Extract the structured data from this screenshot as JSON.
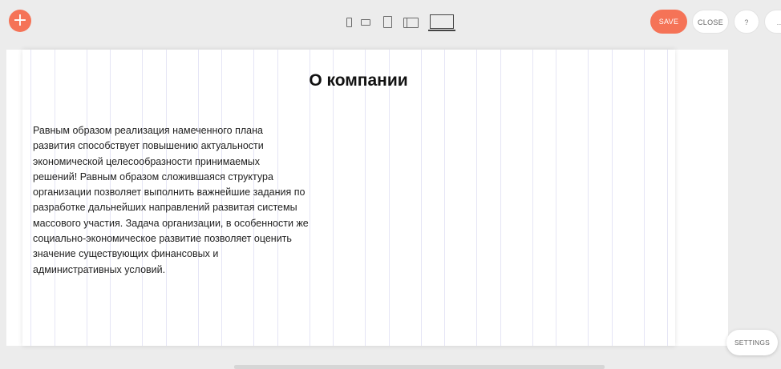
{
  "toolbar": {
    "add_label": "+",
    "devices": [
      {
        "name": "mobile-portrait"
      },
      {
        "name": "mobile-landscape"
      },
      {
        "name": "tablet-portrait"
      },
      {
        "name": "tablet-landscape"
      },
      {
        "name": "desktop"
      }
    ],
    "save_label": "SAVE",
    "close_label": "CLOSE",
    "help_label": "?",
    "more_label": "..."
  },
  "canvas": {
    "heading": "О компании",
    "paragraph_lines": [
      "Равным образом реализация намеченного плана",
      "развития способствует повышению актуальности",
      "экономической целесообразности принимаемых",
      "решений! Равным образом сложившаяся структура",
      "организации позволяет выполнить важнейшие задания по",
      "разработке дальнейших направлений развитая системы",
      "массового участия. Задача организации, в особенности же",
      "социально-экономическое развитие позволяет оценить",
      "значение существующих финансовых и",
      "административных условий."
    ]
  },
  "settings_label": "SETTINGS",
  "colors": {
    "accent": "#f57357",
    "toolbar_bg": "#ececec",
    "canvas_bg": "#ffffff"
  }
}
